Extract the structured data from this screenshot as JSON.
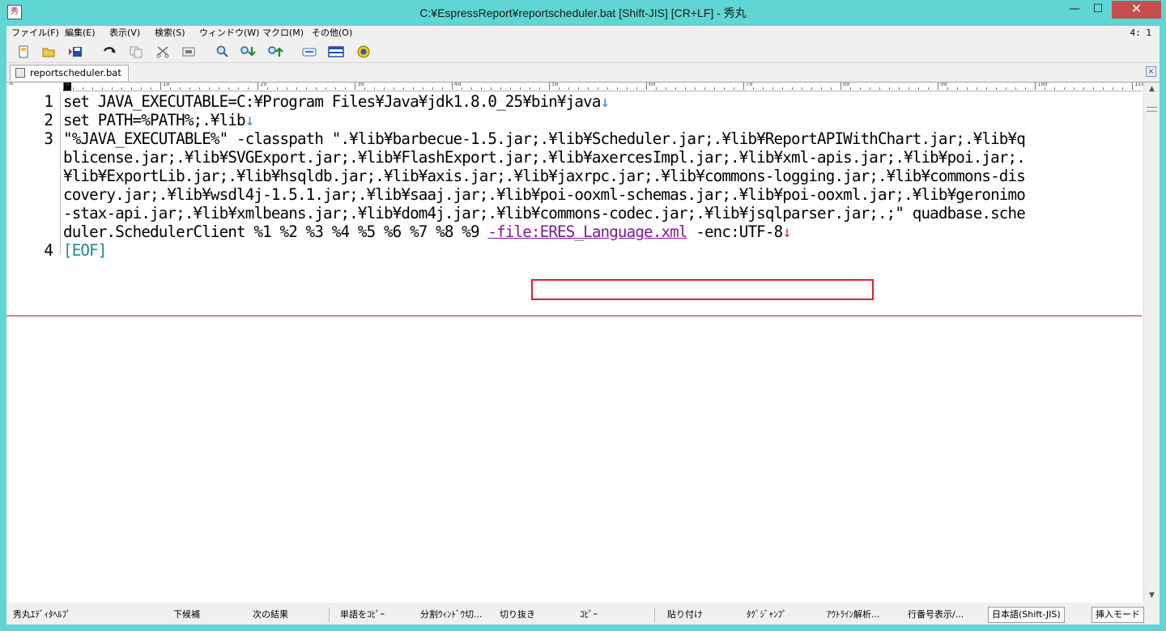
{
  "window": {
    "title": "C:¥EspressReport¥reportscheduler.bat  [Shift-JIS] [CR+LF] - 秀丸",
    "app_icon": "秀",
    "minimize_icon": "minimize-icon",
    "maximize_icon": "maximize-icon",
    "close_icon": "close-icon",
    "minimize_glyph": "—",
    "maximize_glyph": "☐",
    "close_glyph": "✕"
  },
  "menu": {
    "items": [
      "ファイル(F)",
      "編集(E)",
      "表示(V)",
      "検索(S)",
      "ウィンドウ(W)",
      "マクロ(M)",
      "その他(O)"
    ],
    "cursor_position": "4: 1"
  },
  "toolbar": {
    "icons": [
      "new-file-icon",
      "open-folder-icon",
      "save-icon",
      "undo-icon",
      "copy-icon",
      "cut-icon",
      "paste-icon",
      "search-icon",
      "search-down-icon",
      "search-up-icon",
      "keyboard-macro-icon",
      "split-window-icon",
      "help-icon"
    ]
  },
  "tabs": [
    {
      "label": "reportscheduler.bat",
      "close": "×"
    }
  ],
  "editor": {
    "ruler_labels": [
      "0",
      "10",
      "20",
      "30",
      "40",
      "50",
      "60",
      "70",
      "80",
      "90",
      "100",
      "110"
    ],
    "ruler_chevron": "»",
    "line_numbers": [
      "1",
      "2",
      "3",
      "4"
    ],
    "lines": [
      {
        "text": "set JAVA_EXECUTABLE=C:¥Program Files¥Java¥jdk1.8.0_25¥bin¥java",
        "eol": "↓"
      },
      {
        "text": "set PATH=%PATH%;.¥lib",
        "eol": "↓"
      },
      {
        "text": "\"%JAVA_EXECUTABLE%\" -classpath \".¥lib¥barbecue-1.5.jar;.¥lib¥Scheduler.jar;.¥lib¥ReportAPIWithChart.jar;.¥lib¥q"
      },
      {
        "text": "blicense.jar;.¥lib¥SVGExport.jar;.¥lib¥FlashExport.jar;.¥lib¥axercesImpl.jar;.¥lib¥xml-apis.jar;.¥lib¥poi.jar;."
      },
      {
        "text": "¥lib¥ExportLib.jar;.¥lib¥hsqldb.jar;.¥lib¥axis.jar;.¥lib¥jaxrpc.jar;.¥lib¥commons-logging.jar;.¥lib¥commons-dis"
      },
      {
        "text": "covery.jar;.¥lib¥wsdl4j-1.5.1.jar;.¥lib¥saaj.jar;.¥lib¥poi-ooxml-schemas.jar;.¥lib¥poi-ooxml.jar;.¥lib¥geronimo"
      },
      {
        "text": "-stax-api.jar;.¥lib¥xmlbeans.jar;.¥lib¥dom4j.jar;.¥lib¥commons-codec.jar;.¥lib¥jsqlparser.jar;.;\" quadbase.sche"
      },
      {
        "text_before": "duler.SchedulerClient %1 %2 %3 %4 %5 %6 %7 %8 %9 ",
        "purple_part": "-file:ERES_Language.xml",
        "text_after": " -enc:UTF-8",
        "eol": "↓"
      }
    ],
    "eof_marker": "[EOF]"
  },
  "scrollbar": {
    "up": "▲",
    "down": "▼"
  },
  "statusbar": {
    "items": [
      "秀丸ｴﾃﾞｨﾀﾍﾙﾌﾟ",
      "下候補",
      "次の結果",
      "単語をｺﾋﾟｰ",
      "分割ｳｨﾝﾄﾞｳ切...",
      "切り抜き",
      "ｺﾋﾟｰ",
      "貼り付け",
      "ﾀｸﾞｼﾞｬﾝﾌﾟ",
      "ｱｳﾄﾗｲﾝ解析...",
      "行番号表示/..."
    ],
    "encoding": "日本語(Shift-JIS)",
    "insert_mode": "挿入モード"
  }
}
